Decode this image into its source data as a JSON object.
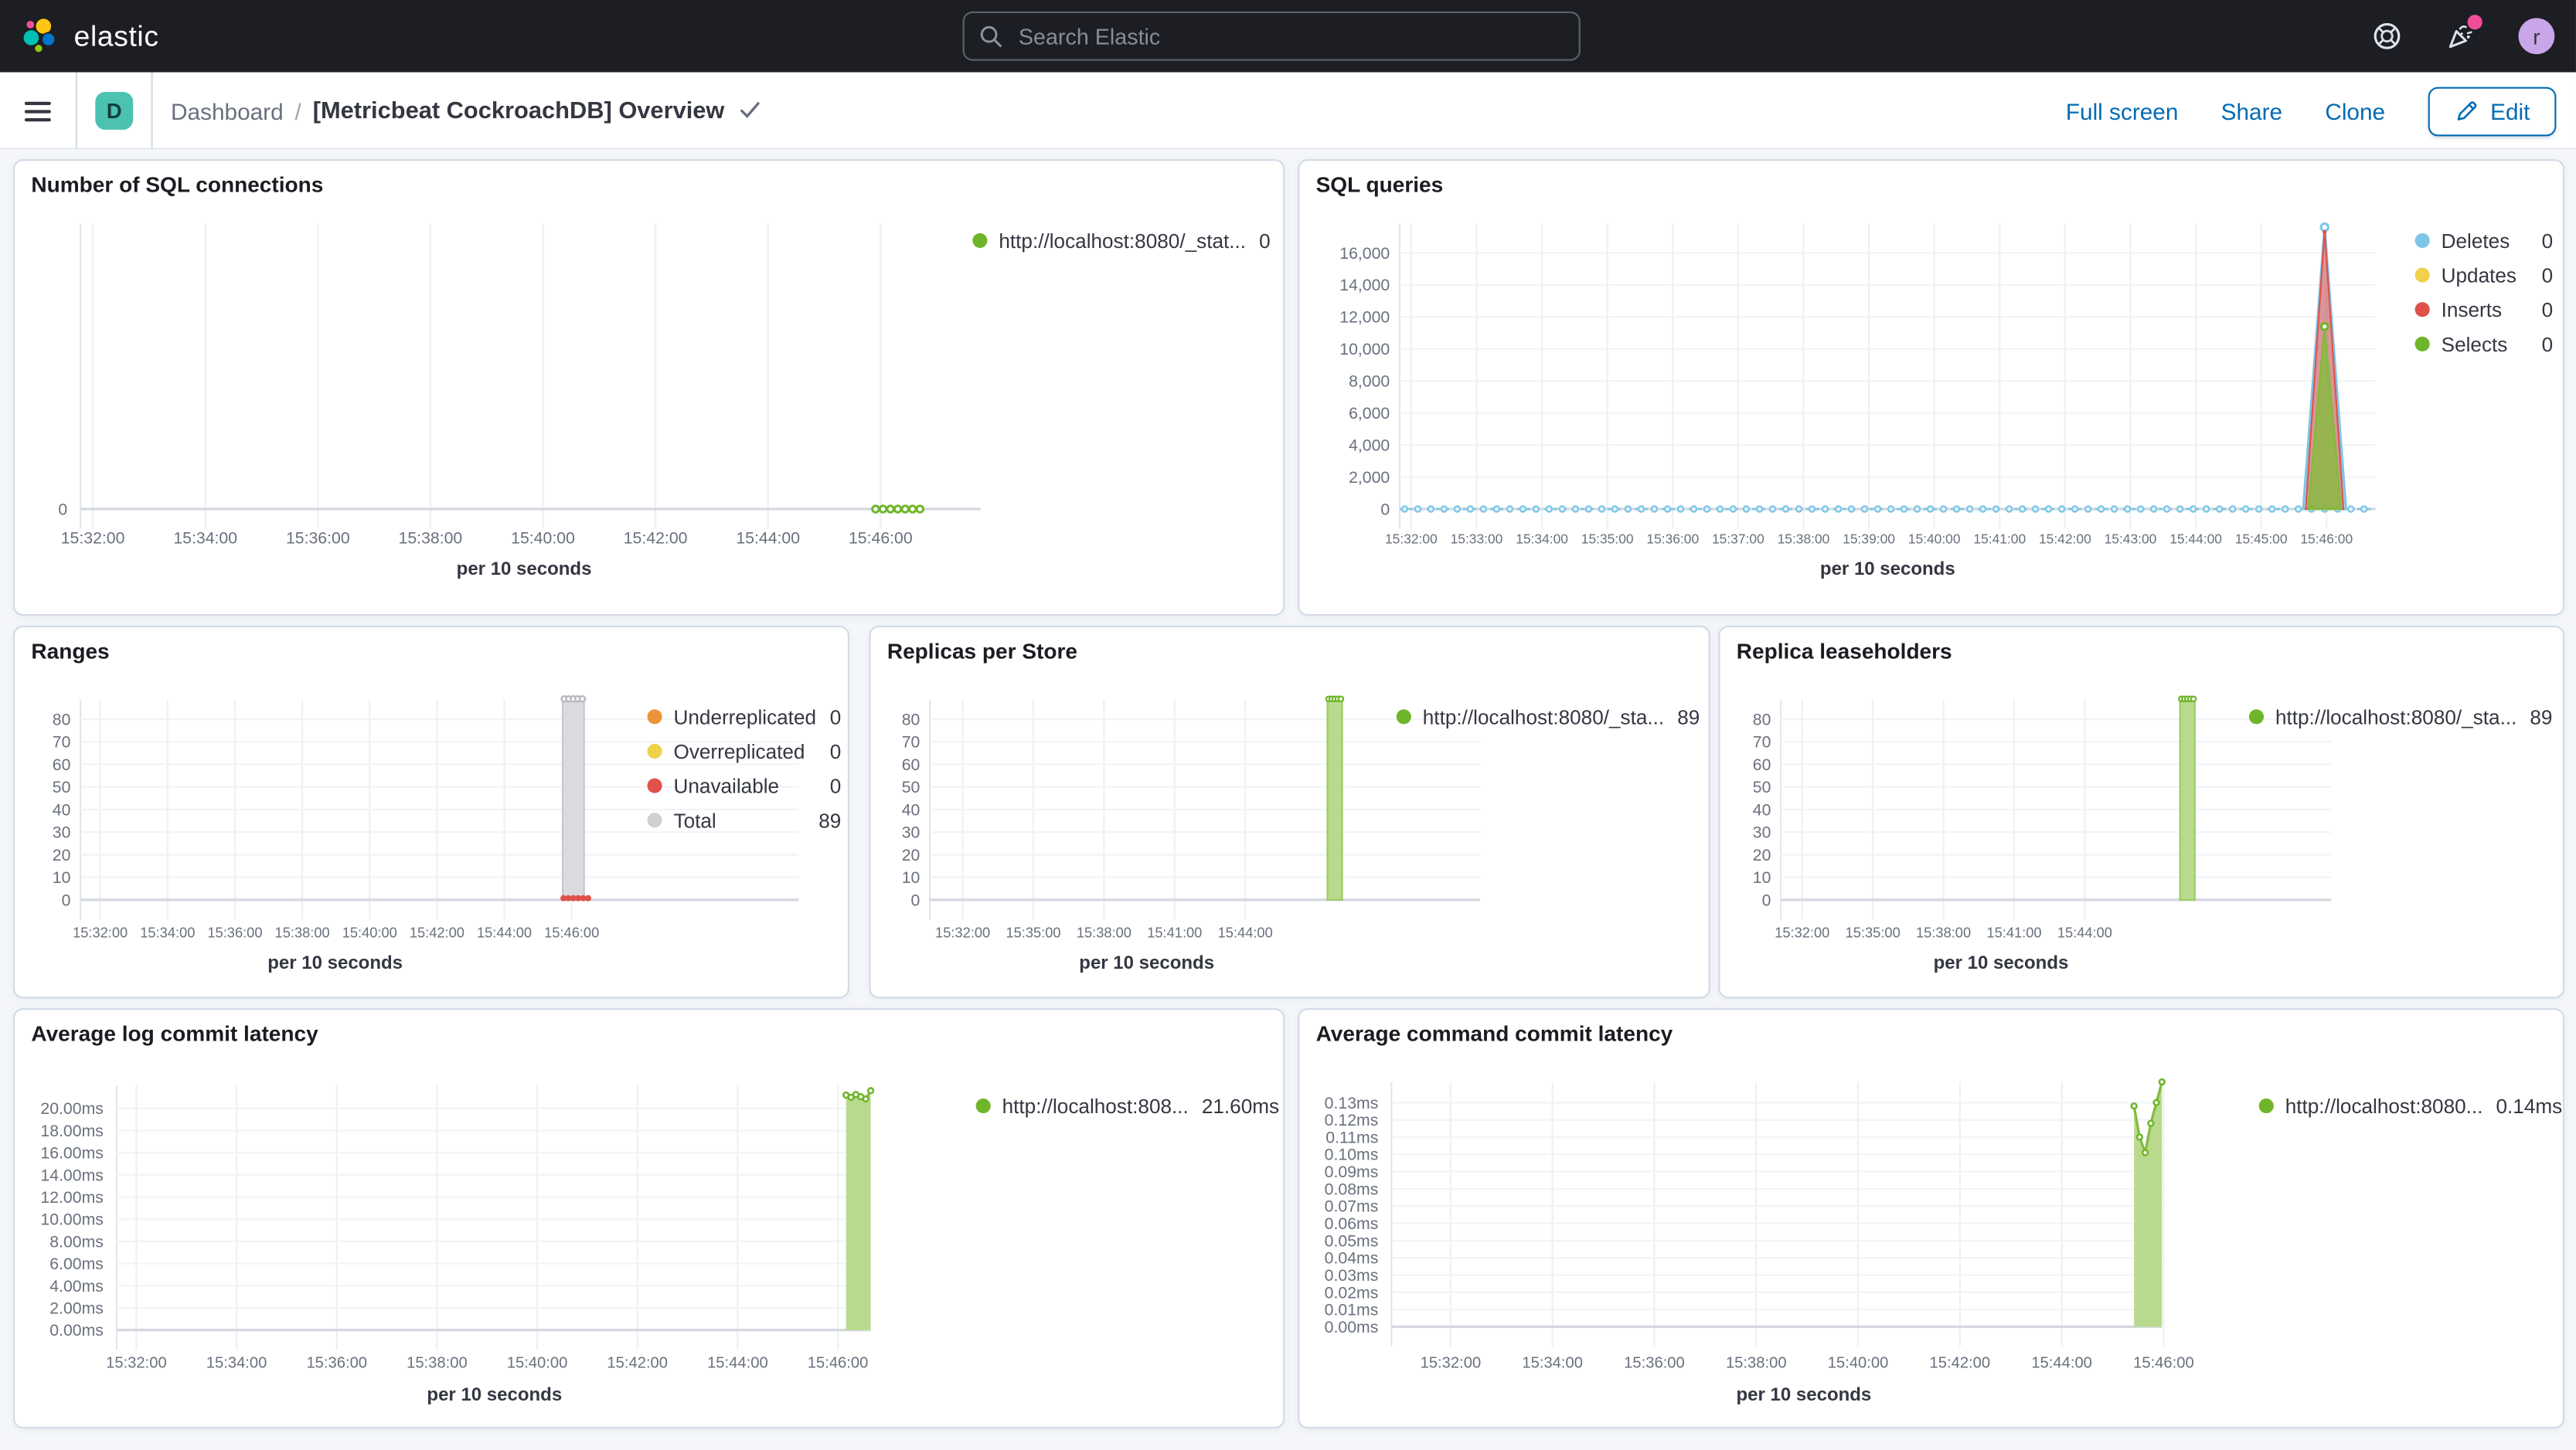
{
  "header": {
    "brand": "elastic",
    "search": {
      "placeholder": "Search Elastic",
      "icon": "magnifier"
    },
    "icons": {
      "help": "life-ring-icon",
      "news": "party-popper-icon",
      "news_badge_color": "#f04e98"
    },
    "avatar": {
      "initial": "r",
      "bg": "#c8a6e8"
    }
  },
  "breadcrumbs": {
    "space_badge": "D",
    "space_badge_bg": "#4cc2b1",
    "section": "Dashboard",
    "separator": "/",
    "current": "[Metricbeat CockroachDB] Overview"
  },
  "actions": {
    "full_screen": "Full screen",
    "share": "Share",
    "clone": "Clone",
    "edit": "Edit"
  },
  "colors": {
    "link_blue": "#006bb4",
    "header_bg": "#1d1e24",
    "panel_border": "#d3dae6",
    "page_bg": "#f4f6fa"
  },
  "chart_data": [
    {
      "id": "sql_connections",
      "type": "line",
      "title": "Number of SQL connections",
      "xlabel": "per 10 seconds",
      "x_ticks": [
        "15:32:00",
        "15:34:00",
        "15:36:00",
        "15:38:00",
        "15:40:00",
        "15:42:00",
        "15:44:00",
        "15:46:00"
      ],
      "y_ticks": [
        "0"
      ],
      "ylim": [
        0,
        1
      ],
      "grid": "vertical",
      "legend_position": "right",
      "series": [
        {
          "name": "http://localhost:8080/_stat...",
          "color": "#6fb52a",
          "legend_value": "0",
          "note": "flat at 0 from ~15:45:30 to 15:46:10",
          "values": [
            0,
            0,
            0,
            0,
            0,
            0,
            0
          ]
        }
      ]
    },
    {
      "id": "sql_queries",
      "type": "line",
      "title": "SQL queries",
      "xlabel": "per 10 seconds",
      "x_ticks": [
        "15:32:00",
        "15:33:00",
        "15:34:00",
        "15:35:00",
        "15:36:00",
        "15:37:00",
        "15:38:00",
        "15:39:00",
        "15:40:00",
        "15:41:00",
        "15:42:00",
        "15:43:00",
        "15:44:00",
        "15:45:00",
        "15:46:00"
      ],
      "y_ticks": [
        "16,000",
        "14,000",
        "12,000",
        "10,000",
        "8,000",
        "6,000",
        "4,000",
        "2,000",
        "0"
      ],
      "ylim": [
        0,
        16000
      ],
      "grid": "both",
      "legend_position": "right",
      "spike_time": "15:45:50",
      "series": [
        {
          "name": "Deletes",
          "color": "#7dc6e8",
          "legend_value": "0",
          "baseline_value": 0,
          "peak": 17600
        },
        {
          "name": "Updates",
          "color": "#f0d24a",
          "legend_value": "0",
          "peak": 0
        },
        {
          "name": "Inserts",
          "color": "#df514a",
          "legend_value": "0",
          "peak": 17400
        },
        {
          "name": "Selects",
          "color": "#6fb52a",
          "legend_value": "0",
          "peak": 11400
        }
      ]
    },
    {
      "id": "ranges",
      "type": "bar",
      "title": "Ranges",
      "xlabel": "per 10 seconds",
      "x_ticks": [
        "15:32:00",
        "15:34:00",
        "15:36:00",
        "15:38:00",
        "15:40:00",
        "15:42:00",
        "15:44:00",
        "15:46:00"
      ],
      "y_ticks": [
        "80",
        "70",
        "60",
        "50",
        "40",
        "30",
        "20",
        "10",
        "0"
      ],
      "ylim": [
        0,
        80
      ],
      "grid": "both",
      "legend_position": "right",
      "bar_time": "15:45:50",
      "series": [
        {
          "name": "Underreplicated",
          "color": "#eb9439",
          "legend_value": "0",
          "value": 0
        },
        {
          "name": "Overreplicated",
          "color": "#f0d24a",
          "legend_value": "0",
          "value": 0
        },
        {
          "name": "Unavailable",
          "color": "#df514a",
          "legend_value": "0",
          "value": 0
        },
        {
          "name": "Total",
          "color": "#d0d0d4",
          "legend_value": "89",
          "value": 89
        }
      ]
    },
    {
      "id": "replicas_per_store",
      "type": "bar",
      "title": "Replicas per Store",
      "xlabel": "per 10 seconds",
      "x_ticks": [
        "15:32:00",
        "15:35:00",
        "15:38:00",
        "15:41:00",
        "15:44:00"
      ],
      "y_ticks": [
        "80",
        "70",
        "60",
        "50",
        "40",
        "30",
        "20",
        "10",
        "0"
      ],
      "ylim": [
        0,
        80
      ],
      "grid": "both",
      "legend_position": "right",
      "bar_time": "15:45:50",
      "series": [
        {
          "name": "http://localhost:8080/_sta...",
          "color": "#6fb52a",
          "legend_value": "89",
          "value": 89
        }
      ]
    },
    {
      "id": "replica_leaseholders",
      "type": "bar",
      "title": "Replica leaseholders",
      "xlabel": "per 10 seconds",
      "x_ticks": [
        "15:32:00",
        "15:35:00",
        "15:38:00",
        "15:41:00",
        "15:44:00"
      ],
      "y_ticks": [
        "80",
        "70",
        "60",
        "50",
        "40",
        "30",
        "20",
        "10",
        "0"
      ],
      "ylim": [
        0,
        80
      ],
      "grid": "both",
      "legend_position": "right",
      "bar_time": "15:45:50",
      "series": [
        {
          "name": "http://localhost:8080/_sta...",
          "color": "#6fb52a",
          "legend_value": "89",
          "value": 89
        }
      ]
    },
    {
      "id": "avg_log_commit_latency",
      "type": "area",
      "title": "Average log commit latency",
      "xlabel": "per 10 seconds",
      "x_ticks": [
        "15:32:00",
        "15:34:00",
        "15:36:00",
        "15:38:00",
        "15:40:00",
        "15:42:00",
        "15:44:00",
        "15:46:00"
      ],
      "y_ticks": [
        "20.00ms",
        "18.00ms",
        "16.00ms",
        "14.00ms",
        "12.00ms",
        "10.00ms",
        "8.00ms",
        "6.00ms",
        "4.00ms",
        "2.00ms",
        "0.00ms"
      ],
      "ylim_ms": [
        0,
        20
      ],
      "grid": "both",
      "legend_position": "right",
      "series": [
        {
          "name": "http://localhost:808...",
          "color": "#6fb52a",
          "legend_value": "21.60ms",
          "values_ms": [
            21.2,
            21.0,
            21.25,
            21.05,
            20.85,
            21.6
          ]
        }
      ]
    },
    {
      "id": "avg_command_commit_latency",
      "type": "area",
      "title": "Average command commit latency",
      "xlabel": "per 10 seconds",
      "x_ticks": [
        "15:32:00",
        "15:34:00",
        "15:36:00",
        "15:38:00",
        "15:40:00",
        "15:42:00",
        "15:44:00",
        "15:46:00"
      ],
      "y_ticks": [
        "0.13ms",
        "0.12ms",
        "0.11ms",
        "0.10ms",
        "0.09ms",
        "0.08ms",
        "0.07ms",
        "0.06ms",
        "0.05ms",
        "0.04ms",
        "0.03ms",
        "0.02ms",
        "0.01ms",
        "0.00ms"
      ],
      "ylim_ms": [
        0,
        0.13
      ],
      "grid": "both",
      "legend_position": "right",
      "series": [
        {
          "name": "http://localhost:8080...",
          "color": "#6fb52a",
          "legend_value": "0.14ms",
          "values_ms": [
            0.128,
            0.11,
            0.101,
            0.118,
            0.13,
            0.142
          ]
        }
      ]
    }
  ]
}
